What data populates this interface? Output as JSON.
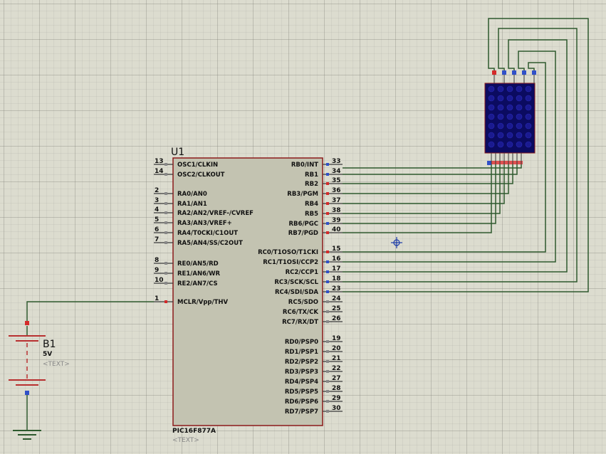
{
  "colors": {
    "background": "#dcdccf",
    "chip_fill": "#c3c3b1",
    "chip_border": "#8b1a1a",
    "wire": "#2e5a2e",
    "pin_red": "#d42a2a",
    "pin_blue": "#3050c8",
    "matrix_fill": "#0b0b60"
  },
  "chip": {
    "ref": "U1",
    "part": "PIC16F877A",
    "text_placeholder": "<TEXT>",
    "left_pins": [
      {
        "num": "13",
        "label": "OSC1/CLKIN"
      },
      {
        "num": "14",
        "label": "OSC2/CLKOUT"
      },
      {
        "num": "2",
        "label": "RA0/AN0"
      },
      {
        "num": "3",
        "label": "RA1/AN1"
      },
      {
        "num": "4",
        "label": "RA2/AN2/VREF-/CVREF"
      },
      {
        "num": "5",
        "label": "RA3/AN3/VREF+"
      },
      {
        "num": "6",
        "label": "RA4/T0CKI/C1OUT"
      },
      {
        "num": "7",
        "label": "RA5/AN4/SS/C2OUT"
      },
      {
        "num": "8",
        "label": "RE0/AN5/RD"
      },
      {
        "num": "9",
        "label": "RE1/AN6/WR"
      },
      {
        "num": "10",
        "label": "RE2/AN7/CS"
      },
      {
        "num": "1",
        "label": "MCLR/Vpp/THV"
      }
    ],
    "right_pins": [
      {
        "num": "33",
        "label": "RB0/INT"
      },
      {
        "num": "34",
        "label": "RB1"
      },
      {
        "num": "35",
        "label": "RB2"
      },
      {
        "num": "36",
        "label": "RB3/PGM"
      },
      {
        "num": "37",
        "label": "RB4"
      },
      {
        "num": "38",
        "label": "RB5"
      },
      {
        "num": "39",
        "label": "RB6/PGC"
      },
      {
        "num": "40",
        "label": "RB7/PGD"
      },
      {
        "num": "15",
        "label": "RC0/T1OSO/T1CKI"
      },
      {
        "num": "16",
        "label": "RC1/T1OSI/CCP2"
      },
      {
        "num": "17",
        "label": "RC2/CCP1"
      },
      {
        "num": "18",
        "label": "RC3/SCK/SCL"
      },
      {
        "num": "23",
        "label": "RC4/SDI/SDA"
      },
      {
        "num": "24",
        "label": "RC5/SDO"
      },
      {
        "num": "25",
        "label": "RC6/TX/CK"
      },
      {
        "num": "26",
        "label": "RC7/RX/DT"
      },
      {
        "num": "19",
        "label": "RD0/PSP0"
      },
      {
        "num": "20",
        "label": "RD1/PSP1"
      },
      {
        "num": "21",
        "label": "RD2/PSP2"
      },
      {
        "num": "22",
        "label": "RD3/PSP3"
      },
      {
        "num": "27",
        "label": "RD4/PSP4"
      },
      {
        "num": "28",
        "label": "RD5/PSP5"
      },
      {
        "num": "29",
        "label": "RD6/PSP6"
      },
      {
        "num": "30",
        "label": "RD7/PSP7"
      }
    ]
  },
  "battery": {
    "ref": "B1",
    "value": "5V",
    "text_placeholder": "<TEXT>"
  },
  "matrix": {
    "cols": 5,
    "rows": 7
  },
  "icons": {
    "cursor": "crosshair-cursor-icon",
    "ground": "ground-icon"
  }
}
